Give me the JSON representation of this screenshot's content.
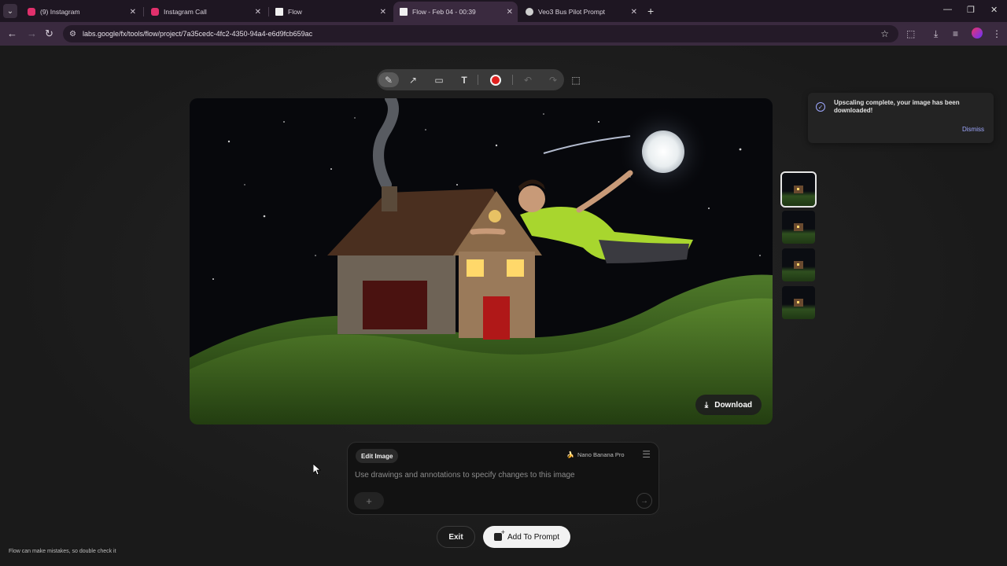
{
  "browser": {
    "tabs": [
      {
        "title": "(9) Instagram",
        "icon": "instagram-icon",
        "color": "#e1306c"
      },
      {
        "title": "Instagram Call",
        "icon": "instagram-icon",
        "color": "#e1306c"
      },
      {
        "title": "Flow",
        "icon": "file-icon",
        "color": "#ffffff"
      },
      {
        "title": "Flow - Feb 04 - 00:39",
        "icon": "file-icon",
        "color": "#ffffff",
        "active": true
      },
      {
        "title": "Veo3 Bus Pilot Prompt",
        "icon": "openai-icon",
        "color": "#cfcfcf"
      }
    ],
    "url": "labs.google/fx/tools/flow/project/7a35cedc-4fc2-4350-94a4-e6d9fcb659ac"
  },
  "drawing_toolbar": {
    "tools": [
      "draw-tool",
      "arrow-tool",
      "rectangle-tool",
      "text-tool",
      "color-picker",
      "undo",
      "redo",
      "select-tool"
    ],
    "selected": "draw-tool",
    "color": "#e0201e"
  },
  "image": {
    "download_label": "Download"
  },
  "thumbnails": {
    "count": 4,
    "selected_index": 0
  },
  "toast": {
    "message": "Upscaling complete, your image has been downloaded!",
    "dismiss_label": "Dismiss"
  },
  "editor": {
    "mode_label": "Edit Image",
    "model_label": "Nano Banana Pro",
    "placeholder": "Use drawings and annotations to specify changes to this image"
  },
  "actions": {
    "exit_label": "Exit",
    "add_to_prompt_label": "Add To Prompt"
  },
  "footer": {
    "disclaimer": "Flow can make mistakes, so double check it"
  },
  "colors": {
    "accent": "#9fa8ff",
    "background": "#1b1b1b",
    "browser_chrome": "#3a2a3f"
  }
}
